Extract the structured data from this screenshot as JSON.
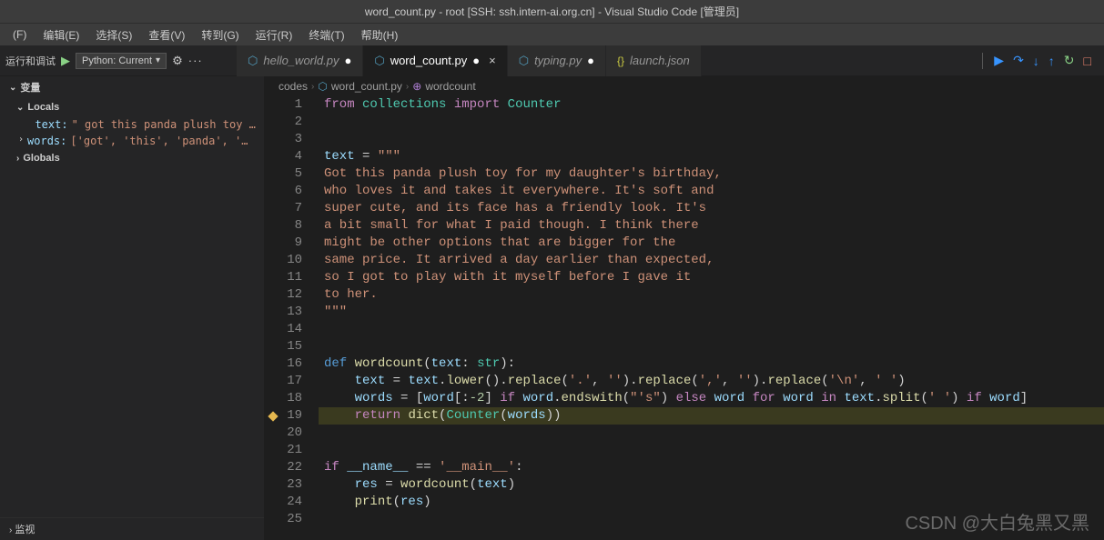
{
  "window_title": "word_count.py - root [SSH: ssh.intern-ai.org.cn] - Visual Studio Code [管理员]",
  "menubar": [
    "(F)",
    "编辑(E)",
    "选择(S)",
    "查看(V)",
    "转到(G)",
    "运行(R)",
    "终端(T)",
    "帮助(H)"
  ],
  "debug": {
    "section": "运行和调试",
    "config": "Python: Current",
    "chevron": "▾"
  },
  "tabs": [
    {
      "label": "hello_world.py",
      "type": "py",
      "active": false,
      "modified": true
    },
    {
      "label": "word_count.py",
      "type": "py",
      "active": true,
      "modified": true
    },
    {
      "label": "typing.py",
      "type": "py",
      "active": false,
      "modified": true
    },
    {
      "label": "launch.json",
      "type": "json",
      "active": false,
      "modified": false
    }
  ],
  "breadcrumb": {
    "folder": "codes",
    "file": "word_count.py",
    "symbol": "wordcount"
  },
  "variables": {
    "header": "变量",
    "locals": "Locals",
    "items": [
      {
        "name": "text",
        "value": "\" got this panda plush toy …"
      },
      {
        "name": "words",
        "value": "['got', 'this', 'panda', '…"
      }
    ],
    "globals": "Globals",
    "watch": "监视"
  },
  "code_lines": [
    {
      "n": 1,
      "tokens": [
        [
          "c-kw",
          "from"
        ],
        [
          "c-op",
          " "
        ],
        [
          "c-mod",
          "collections"
        ],
        [
          "c-op",
          " "
        ],
        [
          "c-kw",
          "import"
        ],
        [
          "c-op",
          " "
        ],
        [
          "c-cls",
          "Counter"
        ]
      ]
    },
    {
      "n": 2,
      "tokens": []
    },
    {
      "n": 3,
      "tokens": []
    },
    {
      "n": 4,
      "tokens": [
        [
          "c-var",
          "text"
        ],
        [
          "c-op",
          " = "
        ],
        [
          "c-str",
          "\"\"\""
        ]
      ]
    },
    {
      "n": 5,
      "tokens": [
        [
          "c-str",
          "Got this panda plush toy for my daughter's birthday,"
        ]
      ]
    },
    {
      "n": 6,
      "tokens": [
        [
          "c-str",
          "who loves it and takes it everywhere. It's soft and"
        ]
      ]
    },
    {
      "n": 7,
      "tokens": [
        [
          "c-str",
          "super cute, and its face has a friendly look. It's"
        ]
      ]
    },
    {
      "n": 8,
      "tokens": [
        [
          "c-str",
          "a bit small for what I paid though. I think there"
        ]
      ]
    },
    {
      "n": 9,
      "tokens": [
        [
          "c-str",
          "might be other options that are bigger for the"
        ]
      ]
    },
    {
      "n": 10,
      "tokens": [
        [
          "c-str",
          "same price. It arrived a day earlier than expected,"
        ]
      ]
    },
    {
      "n": 11,
      "tokens": [
        [
          "c-str",
          "so I got to play with it myself before I gave it"
        ]
      ]
    },
    {
      "n": 12,
      "tokens": [
        [
          "c-str",
          "to her."
        ]
      ]
    },
    {
      "n": 13,
      "tokens": [
        [
          "c-str",
          "\"\"\""
        ]
      ]
    },
    {
      "n": 14,
      "tokens": []
    },
    {
      "n": 15,
      "tokens": []
    },
    {
      "n": 16,
      "tokens": [
        [
          "c-def",
          "def "
        ],
        [
          "c-fn",
          "wordcount"
        ],
        [
          "c-op",
          "("
        ],
        [
          "c-var",
          "text"
        ],
        [
          "c-op",
          ": "
        ],
        [
          "c-cls",
          "str"
        ],
        [
          "c-op",
          "):"
        ]
      ]
    },
    {
      "n": 17,
      "tokens": [
        [
          "c-op",
          "    "
        ],
        [
          "c-var",
          "text"
        ],
        [
          "c-op",
          " = "
        ],
        [
          "c-var",
          "text"
        ],
        [
          "c-op",
          "."
        ],
        [
          "c-fn",
          "lower"
        ],
        [
          "c-op",
          "()."
        ],
        [
          "c-fn",
          "replace"
        ],
        [
          "c-op",
          "("
        ],
        [
          "c-str",
          "'.'"
        ],
        [
          "c-op",
          ", "
        ],
        [
          "c-str",
          "''"
        ],
        [
          "c-op",
          ")."
        ],
        [
          "c-fn",
          "replace"
        ],
        [
          "c-op",
          "("
        ],
        [
          "c-str",
          "','"
        ],
        [
          "c-op",
          ", "
        ],
        [
          "c-str",
          "''"
        ],
        [
          "c-op",
          ")."
        ],
        [
          "c-fn",
          "replace"
        ],
        [
          "c-op",
          "("
        ],
        [
          "c-str",
          "'\\n'"
        ],
        [
          "c-op",
          ", "
        ],
        [
          "c-str",
          "' '"
        ],
        [
          "c-op",
          ")"
        ]
      ]
    },
    {
      "n": 18,
      "tokens": [
        [
          "c-op",
          "    "
        ],
        [
          "c-var",
          "words"
        ],
        [
          "c-op",
          " = ["
        ],
        [
          "c-var",
          "word"
        ],
        [
          "c-op",
          "[:"
        ],
        [
          "c-num",
          "-2"
        ],
        [
          "c-op",
          "] "
        ],
        [
          "c-kw",
          "if"
        ],
        [
          "c-op",
          " "
        ],
        [
          "c-var",
          "word"
        ],
        [
          "c-op",
          "."
        ],
        [
          "c-fn",
          "endswith"
        ],
        [
          "c-op",
          "("
        ],
        [
          "c-str",
          "\"'s\""
        ],
        [
          "c-op",
          ") "
        ],
        [
          "c-kw",
          "else"
        ],
        [
          "c-op",
          " "
        ],
        [
          "c-var",
          "word"
        ],
        [
          "c-op",
          " "
        ],
        [
          "c-kw",
          "for"
        ],
        [
          "c-op",
          " "
        ],
        [
          "c-var",
          "word"
        ],
        [
          "c-op",
          " "
        ],
        [
          "c-kw",
          "in"
        ],
        [
          "c-op",
          " "
        ],
        [
          "c-var",
          "text"
        ],
        [
          "c-op",
          "."
        ],
        [
          "c-fn",
          "split"
        ],
        [
          "c-op",
          "("
        ],
        [
          "c-str",
          "' '"
        ],
        [
          "c-op",
          ") "
        ],
        [
          "c-kw",
          "if"
        ],
        [
          "c-op",
          " "
        ],
        [
          "c-var",
          "word"
        ],
        [
          "c-op",
          "]"
        ]
      ]
    },
    {
      "n": 19,
      "bp": true,
      "hl": true,
      "tokens": [
        [
          "c-op",
          "    "
        ],
        [
          "c-kw",
          "return"
        ],
        [
          "c-op",
          " "
        ],
        [
          "c-fn",
          "dict"
        ],
        [
          "c-op",
          "("
        ],
        [
          "c-cls",
          "Counter"
        ],
        [
          "c-op",
          "("
        ],
        [
          "c-var",
          "words"
        ],
        [
          "c-op",
          "))"
        ]
      ]
    },
    {
      "n": 20,
      "tokens": []
    },
    {
      "n": 21,
      "tokens": []
    },
    {
      "n": 22,
      "tokens": [
        [
          "c-kw",
          "if"
        ],
        [
          "c-op",
          " "
        ],
        [
          "c-var",
          "__name__"
        ],
        [
          "c-op",
          " == "
        ],
        [
          "c-str",
          "'__main__'"
        ],
        [
          "c-op",
          ":"
        ]
      ]
    },
    {
      "n": 23,
      "tokens": [
        [
          "c-op",
          "    "
        ],
        [
          "c-var",
          "res"
        ],
        [
          "c-op",
          " = "
        ],
        [
          "c-fn",
          "wordcount"
        ],
        [
          "c-op",
          "("
        ],
        [
          "c-var",
          "text"
        ],
        [
          "c-op",
          ")"
        ]
      ]
    },
    {
      "n": 24,
      "tokens": [
        [
          "c-op",
          "    "
        ],
        [
          "c-fn",
          "print"
        ],
        [
          "c-op",
          "("
        ],
        [
          "c-var",
          "res"
        ],
        [
          "c-op",
          ")"
        ]
      ]
    },
    {
      "n": 25,
      "tokens": []
    }
  ],
  "watermark": "CSDN @大白兔黑又黑",
  "icons": {
    "play": "▶",
    "gear": "⚙",
    "dots": "···",
    "continue": "▶",
    "step_over": "↷",
    "step_into": "↓",
    "step_out": "↑",
    "restart": "↻",
    "stop": "□",
    "pause": "❚❚",
    "close": "×",
    "chevron_right": "›",
    "chevron_down": "⌄",
    "py": "⬡",
    "json": "{}",
    "fn_icon": "⊕",
    "dot": "●"
  }
}
